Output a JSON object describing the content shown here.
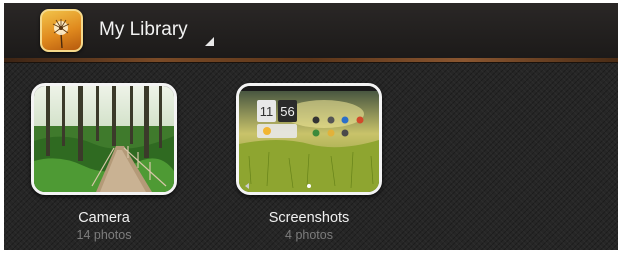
{
  "action_bar": {
    "app_icon": "dandelion-icon",
    "title": "My Library",
    "dropdown_indicator": "dropdown-corner-icon"
  },
  "colors": {
    "action_bar": "#221f1e",
    "wood_accent": "#7a4a26",
    "background": "#262626",
    "label": "#f0f0f0",
    "count": "#7d7d7d"
  },
  "albums": [
    {
      "name": "Camera",
      "count": "14 photos",
      "thumbnail": "forest-boardwalk-photo"
    },
    {
      "name": "Screenshots",
      "count": "4 photos",
      "thumbnail": "tablet-homescreen-screenshot"
    }
  ],
  "screenshot_thumb": {
    "clock_hours": "11",
    "clock_minutes": "56"
  }
}
